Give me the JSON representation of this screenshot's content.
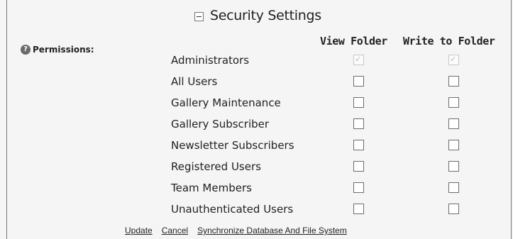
{
  "section": {
    "title": "Security Settings",
    "collapse_icon": "minus-square-icon"
  },
  "permissions": {
    "label": "Permissions:",
    "help_icon": "question-mark-circle-icon",
    "columns": {
      "view": "View Folder",
      "write": "Write to Folder"
    },
    "rows": [
      {
        "label": "Administrators",
        "view": true,
        "write": true,
        "disabled": true
      },
      {
        "label": "All Users",
        "view": false,
        "write": false,
        "disabled": false
      },
      {
        "label": "Gallery Maintenance",
        "view": false,
        "write": false,
        "disabled": false
      },
      {
        "label": "Gallery Subscriber",
        "view": false,
        "write": false,
        "disabled": false
      },
      {
        "label": "Newsletter Subscribers",
        "view": false,
        "write": false,
        "disabled": false
      },
      {
        "label": "Registered Users",
        "view": false,
        "write": false,
        "disabled": false
      },
      {
        "label": "Team Members",
        "view": false,
        "write": false,
        "disabled": false
      },
      {
        "label": "Unauthenticated Users",
        "view": false,
        "write": false,
        "disabled": false
      }
    ]
  },
  "actions": {
    "update": "Update",
    "cancel": "Cancel",
    "sync": "Synchronize Database And File System"
  },
  "colors": {
    "background": "#f5f5f5",
    "border": "#7a7a7a",
    "text": "#222222"
  }
}
